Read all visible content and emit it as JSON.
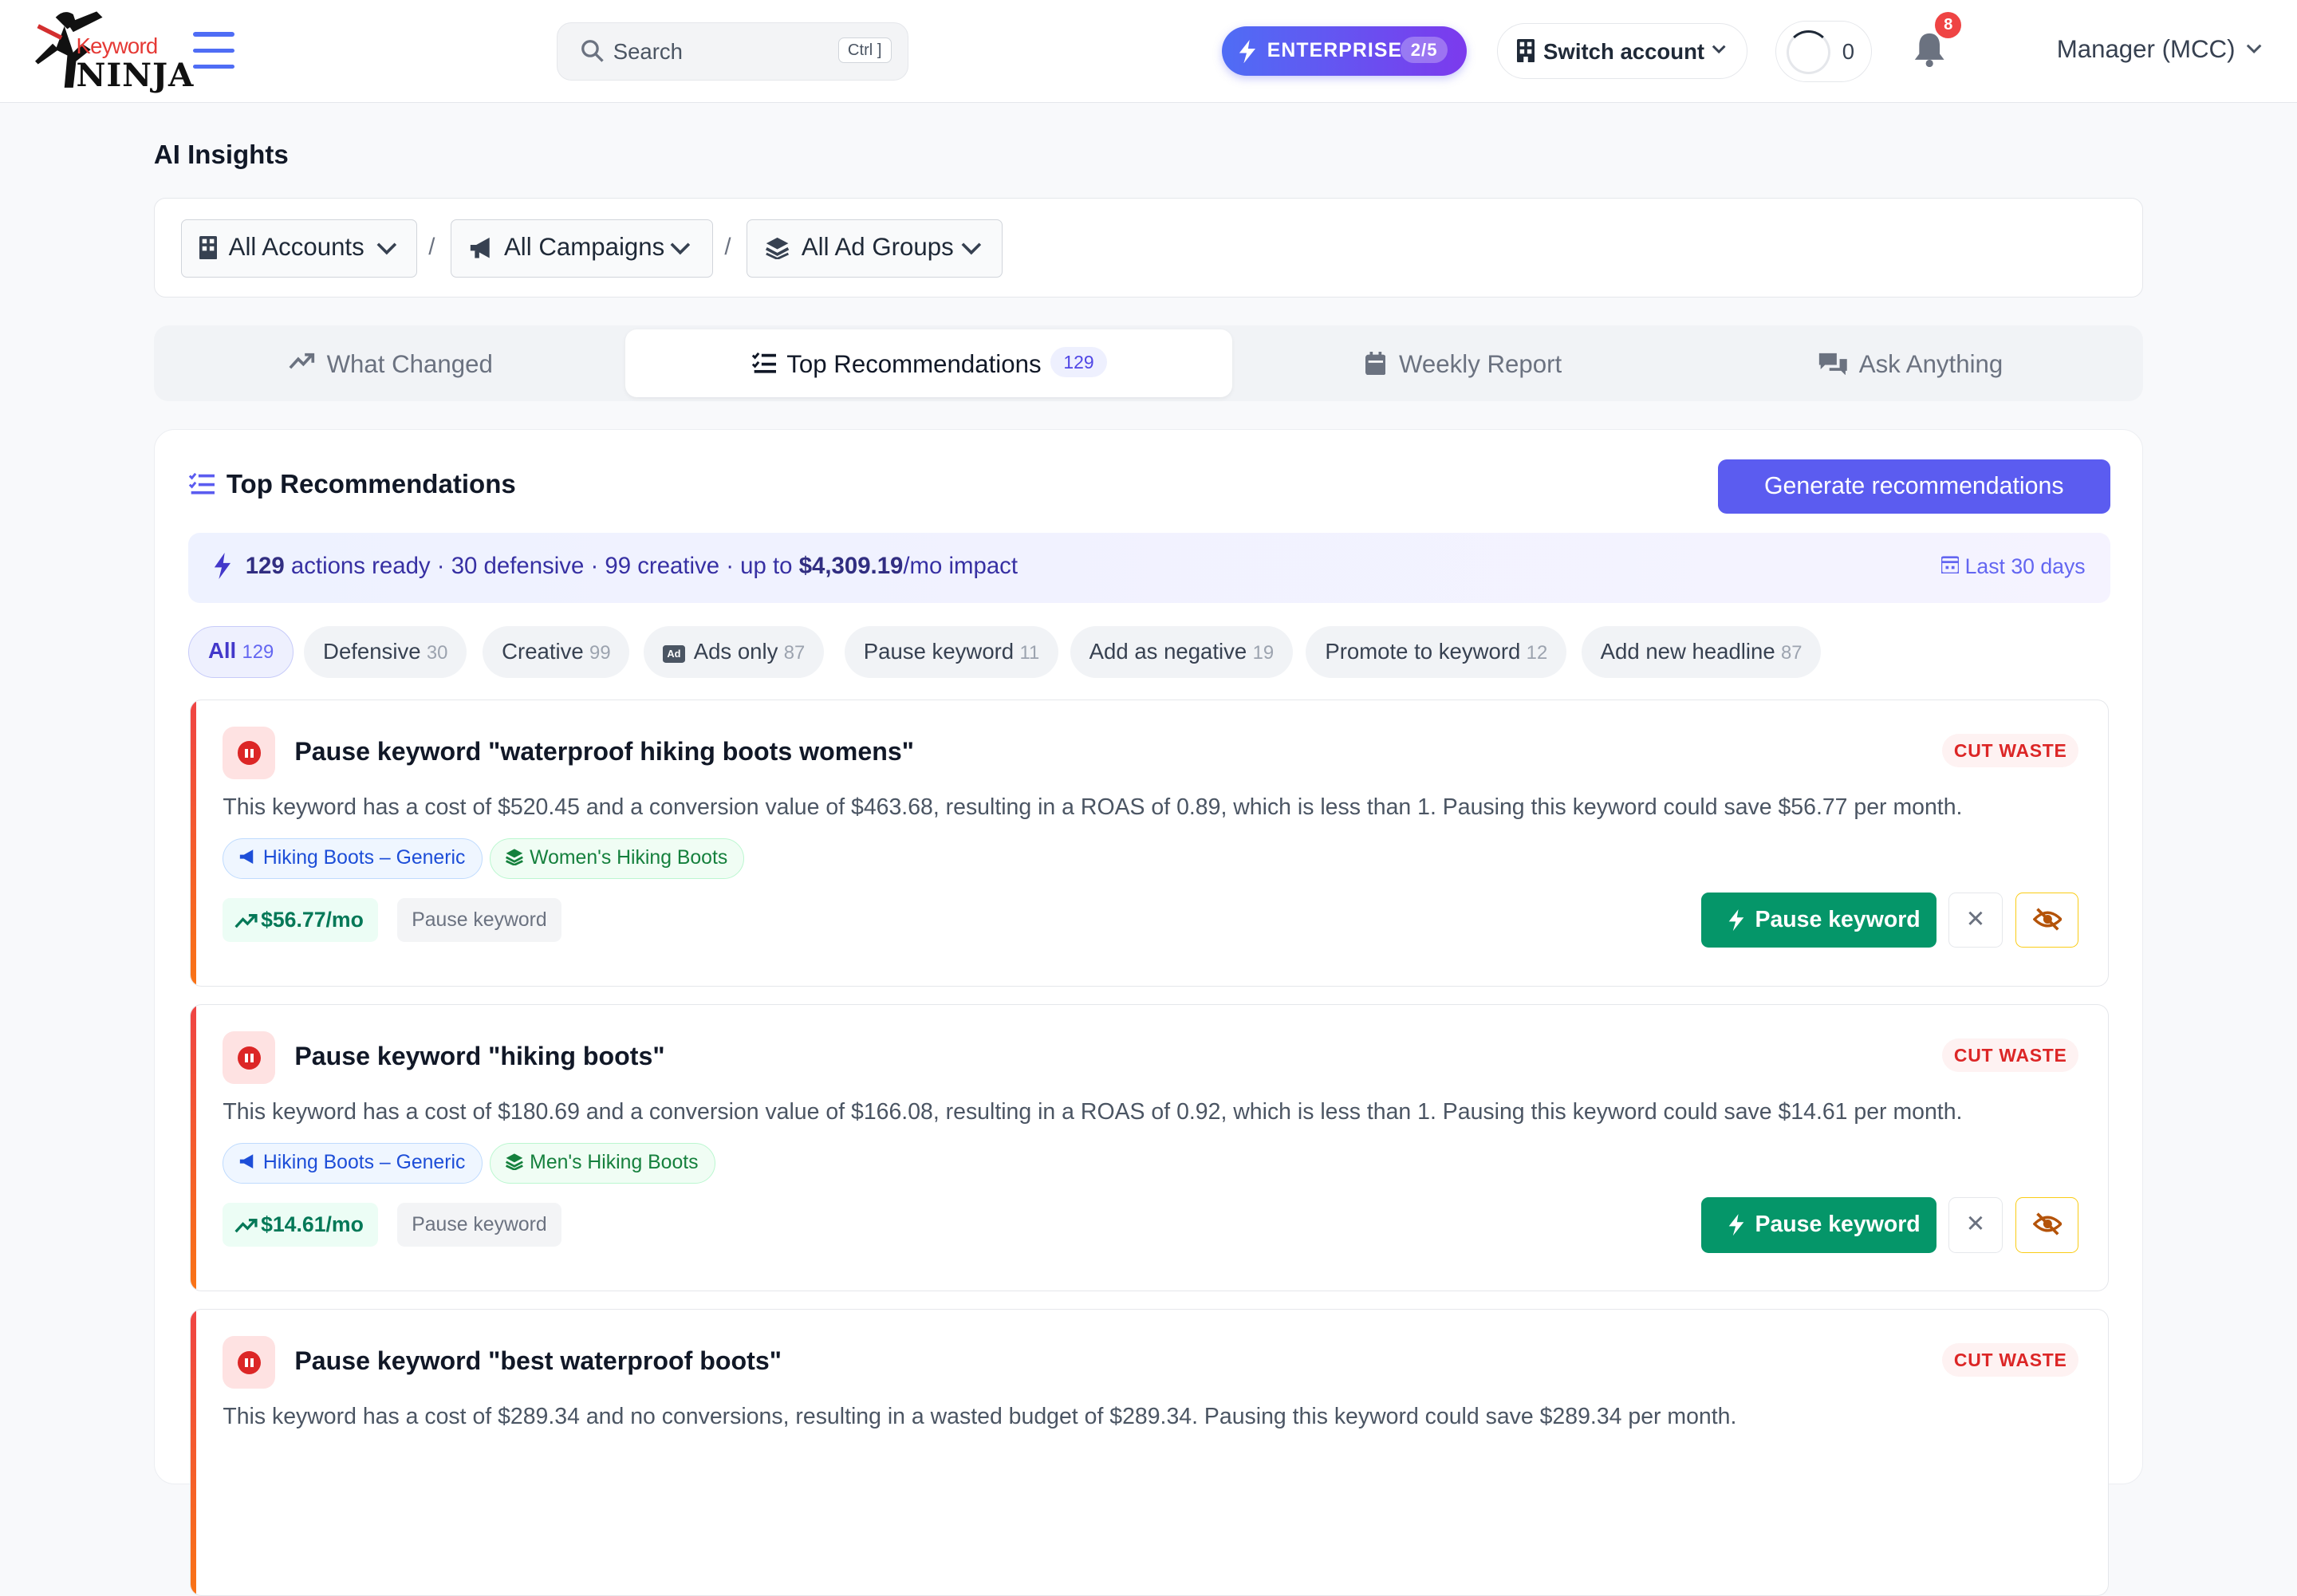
{
  "brand": {
    "logo_top": "Keyword",
    "logo_bottom": "NINJA"
  },
  "search": {
    "placeholder": "Search",
    "shortcut": "Ctrl ]"
  },
  "plan": {
    "label": "ENTERPRISE",
    "count": "2/5"
  },
  "switch_account": "Switch account",
  "credits": "0",
  "notifications": {
    "count": "8"
  },
  "user": "Manager (MCC)",
  "page_title": "AI Insights",
  "filters": {
    "accounts": "All Accounts",
    "campaigns": "All Campaigns",
    "ad_groups": "All Ad Groups",
    "separator": "/"
  },
  "tabs": [
    {
      "label": "What Changed"
    },
    {
      "label": "Top Recommendations",
      "badge": "129"
    },
    {
      "label": "Weekly Report"
    },
    {
      "label": "Ask Anything"
    }
  ],
  "section": {
    "title": "Top Recommendations",
    "generate_label": "Generate recommendations",
    "summary": {
      "count": "129",
      "text_a": " actions ready · 30 defensive · 99 creative · up to ",
      "impact": "$4,309.19",
      "text_b": "/mo impact",
      "range": "Last 30 days"
    }
  },
  "chips": [
    {
      "label": "All",
      "n": "129"
    },
    {
      "label": "Defensive",
      "n": "30"
    },
    {
      "label": "Creative",
      "n": "99"
    },
    {
      "label": "Ads only",
      "n": "87"
    },
    {
      "label": "Pause keyword",
      "n": "11"
    },
    {
      "label": "Add as negative",
      "n": "19"
    },
    {
      "label": "Promote to keyword",
      "n": "12"
    },
    {
      "label": "Add new headline",
      "n": "87"
    }
  ],
  "recs": [
    {
      "title": "Pause keyword \"waterproof hiking boots womens\"",
      "tag": "CUT WASTE",
      "desc": "This keyword has a cost of $520.45 and a conversion value of $463.68, resulting in a ROAS of 0.89, which is less than 1. Pausing this keyword could save $56.77 per month.",
      "campaign": "Hiking Boots – Generic",
      "ad_group": "Women's Hiking Boots",
      "saving": "$56.77/mo",
      "action_label": "Pause keyword",
      "button": "Pause keyword"
    },
    {
      "title": "Pause keyword \"hiking boots\"",
      "tag": "CUT WASTE",
      "desc": "This keyword has a cost of $180.69 and a conversion value of $166.08, resulting in a ROAS of 0.92, which is less than 1. Pausing this keyword could save $14.61 per month.",
      "campaign": "Hiking Boots – Generic",
      "ad_group": "Men's Hiking Boots",
      "saving": "$14.61/mo",
      "action_label": "Pause keyword",
      "button": "Pause keyword"
    },
    {
      "title": "Pause keyword \"best waterproof boots\"",
      "tag": "CUT WASTE",
      "desc": "This keyword has a cost of $289.34 and no conversions, resulting in a wasted budget of $289.34. Pausing this keyword could save $289.34 per month."
    }
  ],
  "colors": {
    "accent": "#5b5cf0",
    "success": "#059669",
    "danger": "#dc2626"
  }
}
